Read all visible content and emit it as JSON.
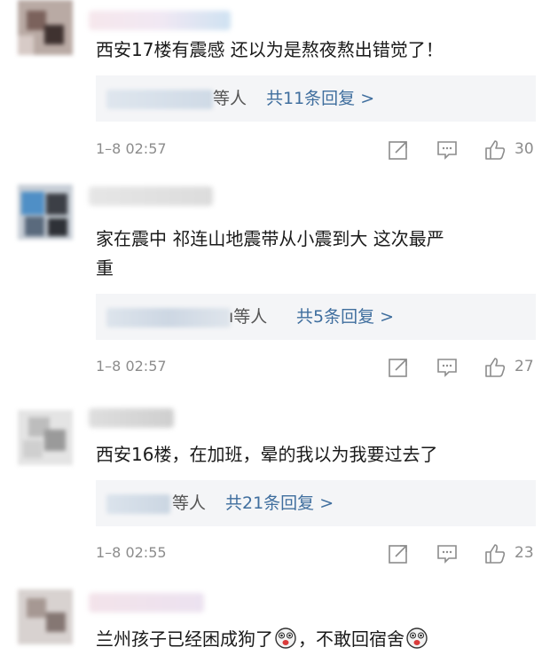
{
  "comments": [
    {
      "text": "西安17楼有震感 还以为是熬夜熬出错觉了！",
      "reply_who": "等人",
      "reply_link": "共11条回复 >",
      "time": "1–8 02:57",
      "likes": "30"
    },
    {
      "text_line1": "家在震中 祁连山地震带从小震到大 这次最严",
      "text_line2": "重",
      "reply_who": "等人",
      "reply_partial": "ı",
      "reply_link": "共5条回复 >",
      "time": "1–8 02:57",
      "likes": "27"
    },
    {
      "text": "西安16楼，在加班，晕的我以为我要过去了",
      "reply_who": "等人",
      "reply_link": "共21条回复 >",
      "time": "1–8 02:55",
      "likes": "23"
    },
    {
      "text_a": "兰州孩子已经困成狗了",
      "text_b": "，不敢回宿舍",
      "emoji": "dizzy-face-emoji"
    }
  ],
  "icons": {
    "share": "share-icon",
    "comment": "comment-icon",
    "like": "thumbs-up-icon"
  },
  "colors": {
    "link": "#3f6e9e",
    "meta": "#8c8c8c",
    "reply_bg": "#f4f5f7"
  }
}
